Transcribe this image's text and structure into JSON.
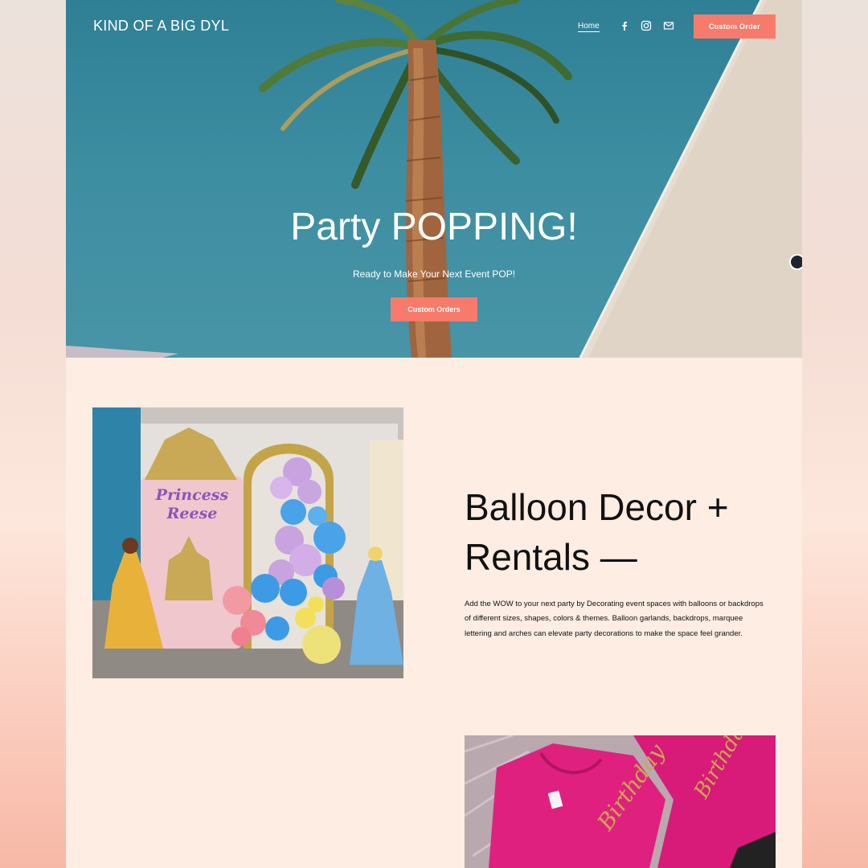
{
  "header": {
    "brand": "KIND OF A BIG DYL",
    "nav_home": "Home",
    "social_icons": [
      "facebook-icon",
      "instagram-icon",
      "email-icon"
    ],
    "cta": "Custom Order"
  },
  "hero": {
    "title": "Party POPPING!",
    "subtitle": "Ready to Make Your Next Event POP!",
    "cta": "Custom Orders"
  },
  "section": {
    "heading_line1": "Balloon Decor +",
    "heading_line2": "Rentals —",
    "paragraph": "Add the WOW to your next party by Decorating event spaces with balloons or backdrops of different sizes, shapes, colors & themes. Balloon garlands, backdrops, marquee lettering and arches can elevate party decorations to make the space feel grander.",
    "image_text": "Princess Reese"
  },
  "colors": {
    "accent": "#f67b6c",
    "section_bg": "#fdede3",
    "sky": "#3d8da1"
  }
}
